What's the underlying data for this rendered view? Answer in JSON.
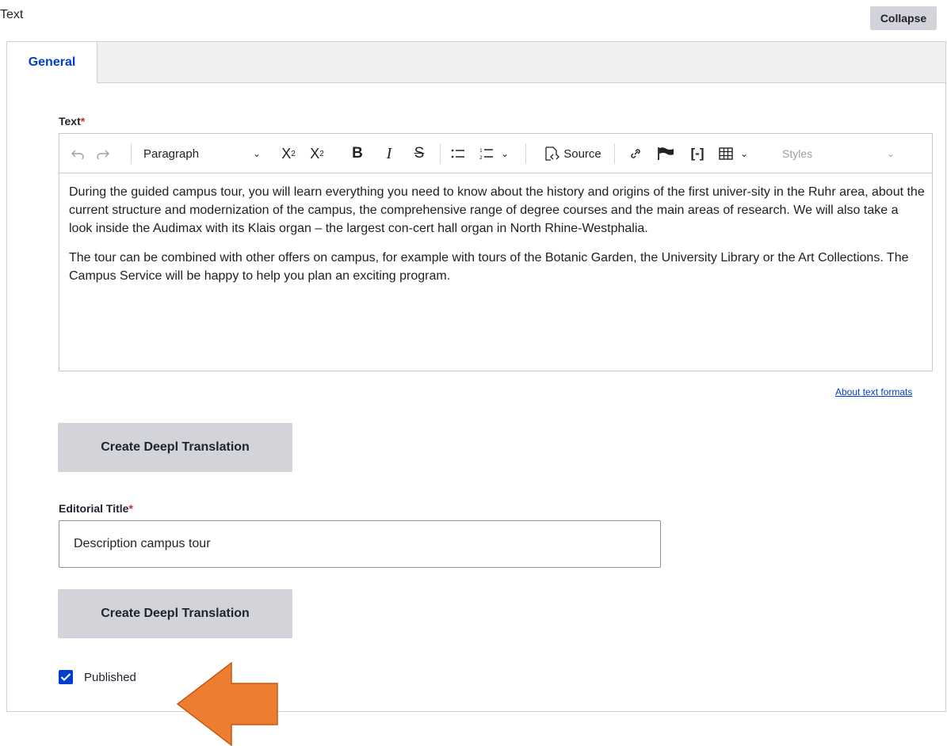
{
  "section": {
    "label": "Text",
    "collapse_label": "Collapse"
  },
  "tabs": [
    {
      "label": "General",
      "active": true
    }
  ],
  "text_field": {
    "label": "Text",
    "required_mark": "*",
    "toolbar": {
      "undo_icon": "undo-icon",
      "redo_icon": "redo-icon",
      "paragraph_select": "Paragraph",
      "source_label": "Source",
      "styles_select": "Styles"
    },
    "paragraphs": [
      "During the guided campus tour, you will learn everything you need to know about the history and origins of the first univer-sity in the Ruhr area, about the current structure and modernization of the campus, the comprehensive range of degree courses and the main areas of research. We will also take a look inside the Audimax with its Klais organ – the largest con-cert hall organ in North Rhine-Westphalia.",
      "The tour can be combined with other offers on campus, for example with tours of the Botanic Garden, the University Library or the Art Collections. The Campus Service will be happy to help you plan an exciting program."
    ],
    "about_formats_link": "About text formats"
  },
  "deepl_button_label": "Create Deepl Translation",
  "editorial_title": {
    "label": "Editorial Title",
    "required_mark": "*",
    "value": "Description campus tour"
  },
  "published": {
    "label": "Published",
    "checked": true
  },
  "colors": {
    "accent": "#003ecc",
    "required": "#dc2323",
    "button_bg": "#d3d4d9",
    "annotation_arrow": "#ed7d31"
  }
}
